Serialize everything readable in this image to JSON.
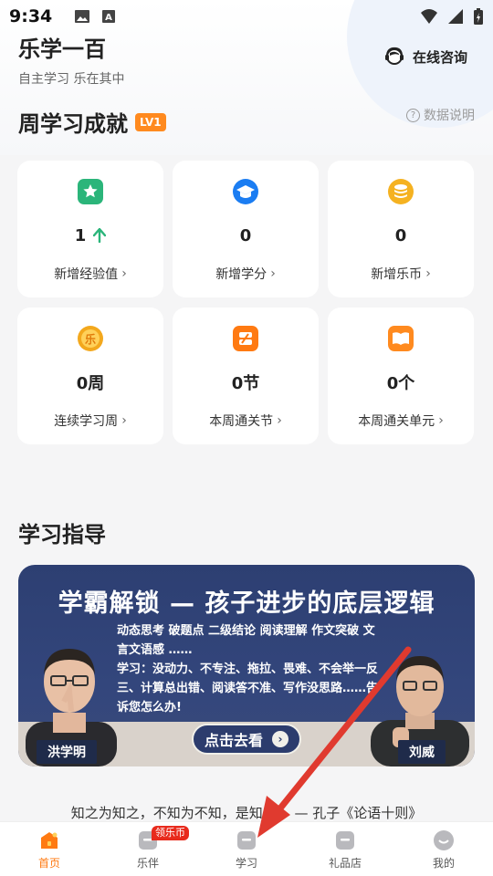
{
  "status_bar": {
    "time": "9:34"
  },
  "header": {
    "app_title": "乐学一百",
    "subtitle": "自主学习 乐在其中",
    "consult_label": "在线咨询"
  },
  "achievement": {
    "title": "周学习成就",
    "level_badge": "LV1",
    "help_label": "数据说明",
    "cards": [
      {
        "value": "1",
        "label": "新增经验值",
        "icon": "star-icon",
        "trend": "up-arrow-icon"
      },
      {
        "value": "0",
        "label": "新增学分",
        "icon": "graduation-cap-icon"
      },
      {
        "value": "0",
        "label": "新增乐币",
        "icon": "coin-stack-icon"
      },
      {
        "value": "0周",
        "label": "连续学习周",
        "icon": "le-coin-icon"
      },
      {
        "value": "0节",
        "label": "本周通关节",
        "icon": "lesson-icon"
      },
      {
        "value": "0个",
        "label": "本周通关单元",
        "icon": "book-icon"
      }
    ]
  },
  "guide": {
    "title": "学习指导",
    "banner": {
      "headline": "学霸解锁 — 孩子进步的底层逻辑",
      "body": "动态思考  破题点  二级结论  阅读理解  作文突破  文言文语感 ……\n学习：没动力、不专注、拖拉、畏难、不会举一反三、计算总出错、阅读答不准、写作没思路……告诉您怎么办!",
      "cta": "点击去看",
      "teacher_left": "洪学明",
      "teacher_right": "刘威"
    }
  },
  "quote": "知之为知之，不知为不知，是知也。 — 孔子《论语十则》",
  "tabbar": {
    "items": [
      {
        "label": "首页",
        "icon": "home-icon",
        "active": true
      },
      {
        "label": "乐伴",
        "icon": "companion-icon",
        "badge": "领乐币"
      },
      {
        "label": "学习",
        "icon": "study-icon"
      },
      {
        "label": "礼品店",
        "icon": "gift-shop-icon"
      },
      {
        "label": "我的",
        "icon": "profile-icon"
      }
    ]
  },
  "colors": {
    "accent_orange": "#ff7a12",
    "badge_orange": "#ff8a1f",
    "banner_navy": "#2d3f72",
    "annotation_red": "#e03a2f"
  }
}
